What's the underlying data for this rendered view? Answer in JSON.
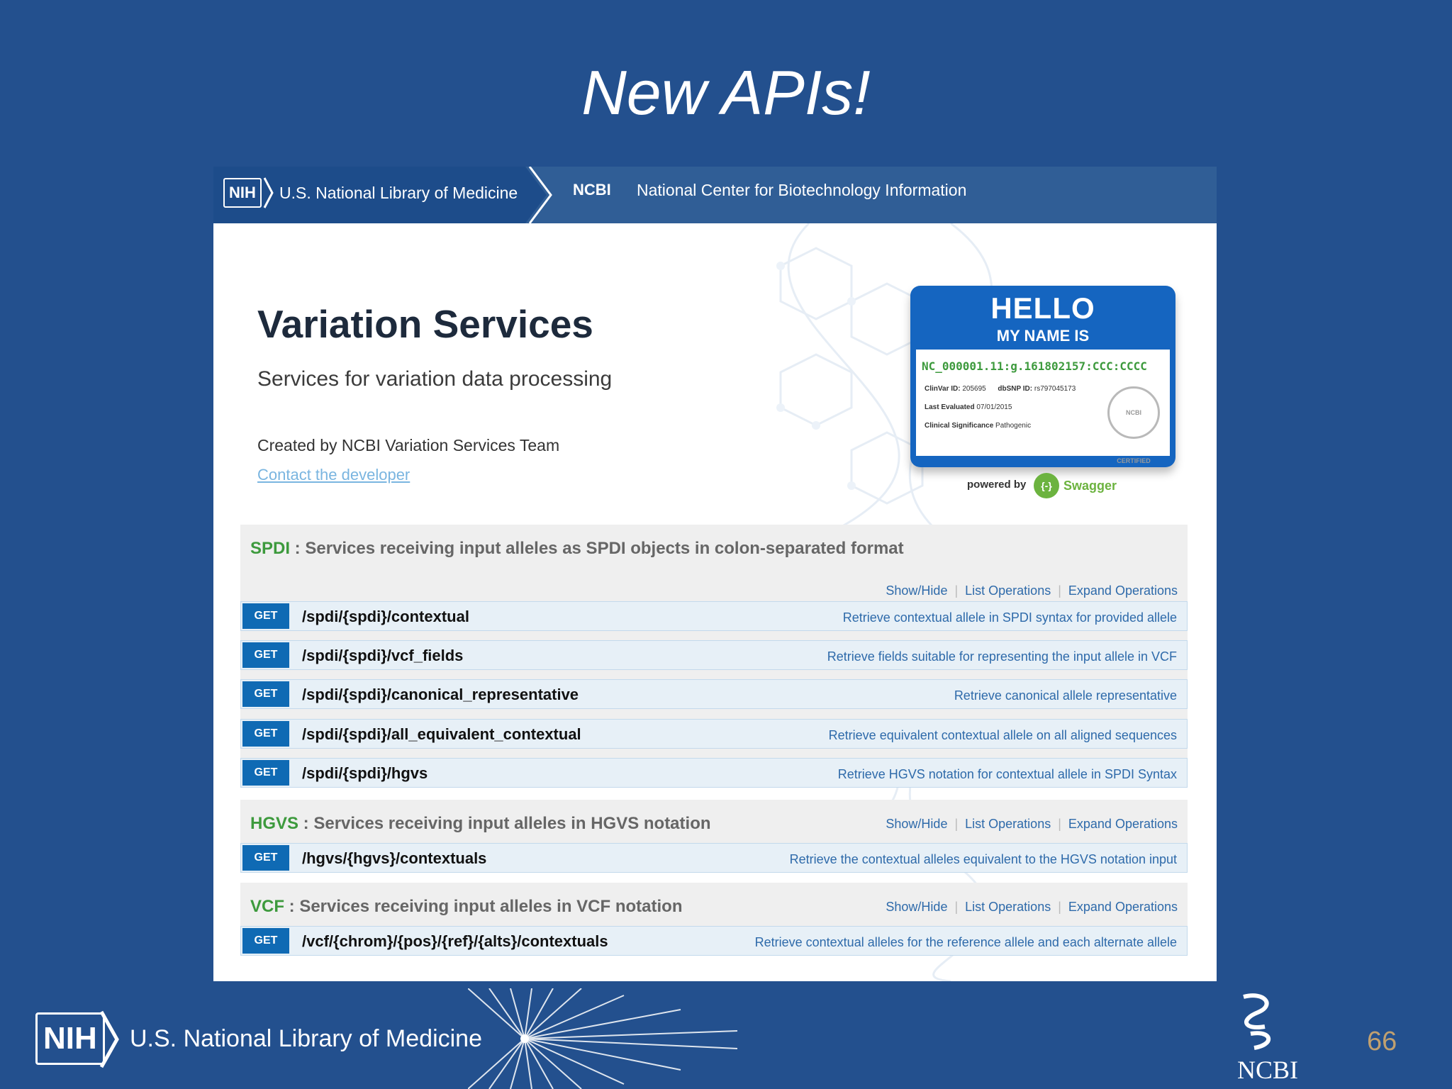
{
  "slide": {
    "title": "New APIs!",
    "page_number": "66"
  },
  "header": {
    "nih_badge": "NIH",
    "nlm": "U.S. National Library of Medicine",
    "ncbi": "NCBI",
    "ncbi_full": "National Center for Biotechnology Information"
  },
  "service": {
    "title": "Variation Services",
    "description": "Services for variation data processing",
    "created_by": "Created by NCBI Variation Services Team",
    "contact": "Contact the developer"
  },
  "hello_badge": {
    "heading": "HELLO",
    "subheading": "MY NAME IS",
    "identifier": "NC_000001.11:g.161802157:CCC:CCCC",
    "clinvar_label": "ClinVar ID:",
    "clinvar_value": "205695",
    "dbsnp_label": "dbSNP ID:",
    "dbsnp_value": "rs797045173",
    "last_eval_label": "Last Evaluated",
    "last_eval_value": "07/01/2015",
    "clin_sig_label": "Clinical Significance",
    "clin_sig_value": "Pathogenic",
    "seal": "NCBI CERTIFIED"
  },
  "powered": {
    "label": "powered by",
    "brand": "Swagger",
    "logo_glyph": "{-}"
  },
  "ops_links": {
    "show_hide": "Show/Hide",
    "list": "List Operations",
    "expand": "Expand Operations"
  },
  "groups": [
    {
      "tag": "SPDI",
      "title": " : Services receiving input alleles as SPDI objects in colon-separated format",
      "operations": [
        {
          "method": "GET",
          "path": "/spdi/{spdi}/contextual",
          "description": "Retrieve contextual allele in SPDI syntax for provided allele"
        },
        {
          "method": "GET",
          "path": "/spdi/{spdi}/vcf_fields",
          "description": "Retrieve fields suitable for representing the input allele in VCF"
        },
        {
          "method": "GET",
          "path": "/spdi/{spdi}/canonical_representative",
          "description": "Retrieve canonical allele representative"
        },
        {
          "method": "GET",
          "path": "/spdi/{spdi}/all_equivalent_contextual",
          "description": "Retrieve equivalent contextual allele on all aligned sequences"
        },
        {
          "method": "GET",
          "path": "/spdi/{spdi}/hgvs",
          "description": "Retrieve HGVS notation for contextual allele in SPDI Syntax"
        }
      ]
    },
    {
      "tag": "HGVS",
      "title": " : Services receiving input alleles in HGVS notation",
      "operations": [
        {
          "method": "GET",
          "path": "/hgvs/{hgvs}/contextuals",
          "description": "Retrieve the contextual alleles equivalent to the HGVS notation input"
        }
      ]
    },
    {
      "tag": "VCF",
      "title": " : Services receiving input alleles in VCF notation",
      "operations": [
        {
          "method": "GET",
          "path": "/vcf/{chrom}/{pos}/{ref}/{alts}/contextuals",
          "description": "Retrieve contextual alleles for the reference allele and each alternate allele"
        }
      ]
    }
  ],
  "footer": {
    "nih_badge": "NIH",
    "nlm": "U.S. National Library of Medicine",
    "ncbi": "NCBI"
  }
}
